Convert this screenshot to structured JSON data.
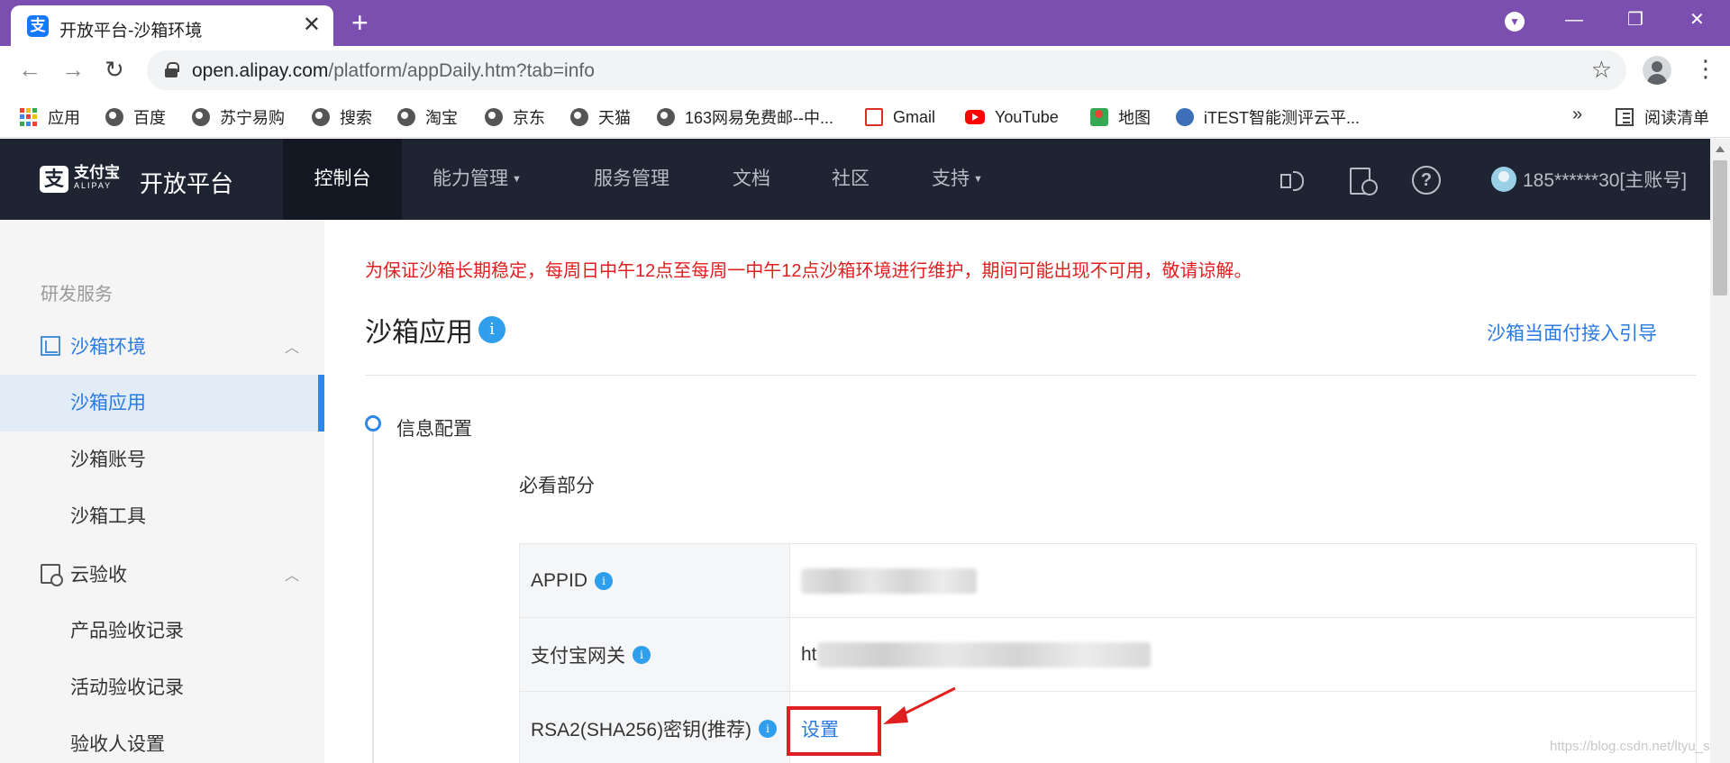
{
  "browser": {
    "tab_title": "开放平台-沙箱环境",
    "tab_close": "✕",
    "new_tab": "+",
    "url_host": "open.alipay.com",
    "url_path": "/platform/appDaily.htm?tab=info",
    "bookmarks": [
      {
        "label": "应用",
        "icon": "apps-icon"
      },
      {
        "label": "百度",
        "icon": "globe-icon"
      },
      {
        "label": "苏宁易购",
        "icon": "globe-icon"
      },
      {
        "label": "搜索",
        "icon": "globe-icon"
      },
      {
        "label": "淘宝",
        "icon": "globe-icon"
      },
      {
        "label": "京东",
        "icon": "globe-icon"
      },
      {
        "label": "天猫",
        "icon": "globe-icon"
      },
      {
        "label": "163网易免费邮--中...",
        "icon": "globe-icon"
      },
      {
        "label": "Gmail",
        "icon": "gmail-icon"
      },
      {
        "label": "YouTube",
        "icon": "youtube-icon"
      },
      {
        "label": "地图",
        "icon": "maps-icon"
      },
      {
        "label": "iTEST智能测评云平...",
        "icon": "itest-icon"
      }
    ],
    "bookmarks_more": "»",
    "reading_list": "阅读清单"
  },
  "header": {
    "logo_cn": "支付宝",
    "logo_en": "ALIPAY",
    "title": "开放平台",
    "nav": [
      {
        "label": "控制台",
        "dropdown": false
      },
      {
        "label": "能力管理",
        "dropdown": true
      },
      {
        "label": "服务管理",
        "dropdown": false
      },
      {
        "label": "文档",
        "dropdown": false
      },
      {
        "label": "社区",
        "dropdown": false
      },
      {
        "label": "支持",
        "dropdown": true
      }
    ],
    "user": "185******30[主账号]"
  },
  "sidebar": {
    "section": "研发服务",
    "groups": [
      {
        "label": "沙箱环境",
        "icon": "cube-icon",
        "items": [
          "沙箱应用",
          "沙箱账号",
          "沙箱工具"
        ]
      },
      {
        "label": "云验收",
        "icon": "check-doc-icon",
        "items": [
          "产品验收记录",
          "活动验收记录",
          "验收人设置"
        ]
      }
    ]
  },
  "main": {
    "notice": "为保证沙箱长期稳定，每周日中午12点至每周一中午12点沙箱环境进行维护，期间可能出现不可用，敬请谅解。",
    "title": "沙箱应用",
    "guide_link": "沙箱当面付接入引导",
    "step_title": "信息配置",
    "must_read": "必看部分",
    "rows": [
      {
        "key": "APPID",
        "value": ""
      },
      {
        "key": "支付宝网关",
        "value": "ht"
      },
      {
        "key": "RSA2(SHA256)密钥(推荐)",
        "value": "设置"
      }
    ]
  },
  "watermark": "https://blog.csdn.net/ltyu_sk",
  "colors": {
    "chrome_purple": "#7b4fb0",
    "header_bg": "#1f2433",
    "accent_blue": "#2a7ae2",
    "notice_red": "#e02020"
  }
}
